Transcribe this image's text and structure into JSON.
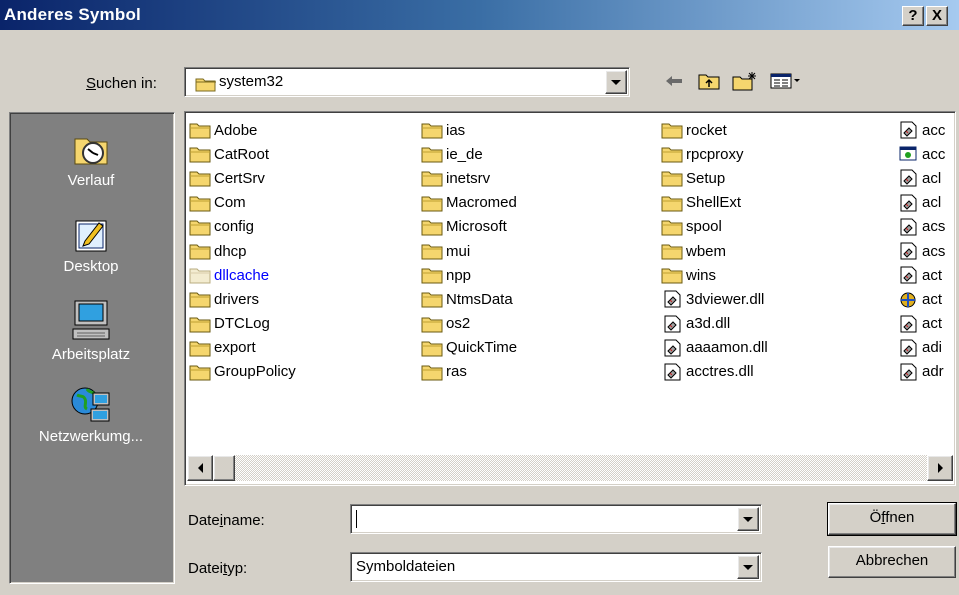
{
  "window": {
    "title": "Anderes Symbol",
    "help_button": "?",
    "close_button": "X"
  },
  "lookin": {
    "label_prefix": "",
    "label_access": "S",
    "label_rest": "uchen in:",
    "value": "system32"
  },
  "toolbar": {
    "back_icon": "back-arrow-icon",
    "up_icon": "up-folder-icon",
    "new_folder_icon": "new-folder-icon",
    "view_menu_icon": "view-menu-icon"
  },
  "places": [
    {
      "label": "Verlauf",
      "icon": "history-icon"
    },
    {
      "label": "Desktop",
      "icon": "desktop-icon"
    },
    {
      "label": "Arbeitsplatz",
      "icon": "my-computer-icon"
    },
    {
      "label": "Netzwerkumg...",
      "icon": "network-icon"
    }
  ],
  "files": {
    "col1": [
      {
        "name": "Adobe",
        "type": "folder"
      },
      {
        "name": "CatRoot",
        "type": "folder"
      },
      {
        "name": "CertSrv",
        "type": "folder"
      },
      {
        "name": "Com",
        "type": "folder"
      },
      {
        "name": "config",
        "type": "folder"
      },
      {
        "name": "dhcp",
        "type": "folder"
      },
      {
        "name": "dllcache",
        "type": "folder-hidden"
      },
      {
        "name": "drivers",
        "type": "folder"
      },
      {
        "name": "DTCLog",
        "type": "folder"
      },
      {
        "name": "export",
        "type": "folder"
      },
      {
        "name": "GroupPolicy",
        "type": "folder"
      }
    ],
    "col2": [
      {
        "name": "ias",
        "type": "folder"
      },
      {
        "name": "ie_de",
        "type": "folder"
      },
      {
        "name": "inetsrv",
        "type": "folder"
      },
      {
        "name": "Macromed",
        "type": "folder"
      },
      {
        "name": "Microsoft",
        "type": "folder"
      },
      {
        "name": "mui",
        "type": "folder"
      },
      {
        "name": "npp",
        "type": "folder"
      },
      {
        "name": "NtmsData",
        "type": "folder"
      },
      {
        "name": "os2",
        "type": "folder"
      },
      {
        "name": "QuickTime",
        "type": "folder"
      },
      {
        "name": "ras",
        "type": "folder"
      }
    ],
    "col3": [
      {
        "name": "rocket",
        "type": "folder"
      },
      {
        "name": "rpcproxy",
        "type": "folder"
      },
      {
        "name": "Setup",
        "type": "folder"
      },
      {
        "name": "ShellExt",
        "type": "folder"
      },
      {
        "name": "spool",
        "type": "folder"
      },
      {
        "name": "wbem",
        "type": "folder"
      },
      {
        "name": "wins",
        "type": "folder"
      },
      {
        "name": "3dviewer.dll",
        "type": "dll"
      },
      {
        "name": "a3d.dll",
        "type": "dll"
      },
      {
        "name": "aaaamon.dll",
        "type": "dll"
      },
      {
        "name": "acctres.dll",
        "type": "dll"
      }
    ],
    "col4": [
      {
        "name": "acc",
        "type": "dll"
      },
      {
        "name": "acc",
        "type": "app"
      },
      {
        "name": "acl",
        "type": "dll"
      },
      {
        "name": "acl",
        "type": "dll"
      },
      {
        "name": "acs",
        "type": "dll"
      },
      {
        "name": "acs",
        "type": "dll"
      },
      {
        "name": "act",
        "type": "dll"
      },
      {
        "name": "act",
        "type": "ax"
      },
      {
        "name": "act",
        "type": "dll"
      },
      {
        "name": "adi",
        "type": "dll"
      },
      {
        "name": "adr",
        "type": "dll"
      }
    ]
  },
  "form": {
    "filename_label_pre": "Date",
    "filename_label_access": "i",
    "filename_label_post": "name:",
    "filename_value": "",
    "filetype_label_pre": "Datei",
    "filetype_label_access": "t",
    "filetype_label_post": "yp:",
    "filetype_value": "Symboldateien",
    "open_pre": "Ö",
    "open_access": "f",
    "open_post": "fnen",
    "cancel_label": "Abbrechen"
  },
  "colors": {
    "title_start": "#0a246a",
    "title_end": "#a6caf0",
    "face": "#d4d0c8",
    "places_bg": "#808080",
    "folder": "#f5d66e",
    "hidden_text": "#0000ff"
  }
}
